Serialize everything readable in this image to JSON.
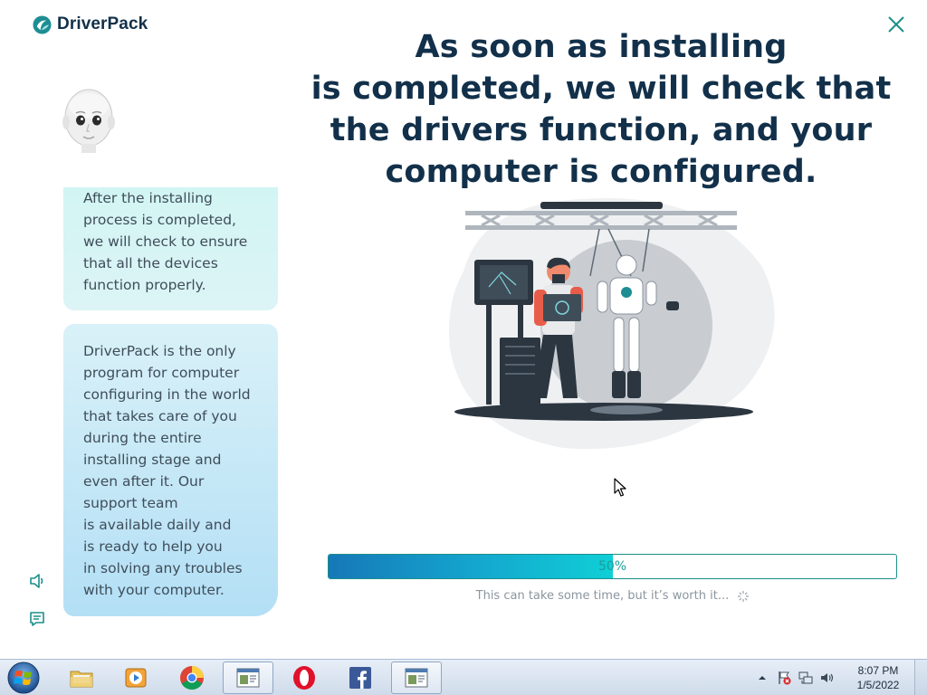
{
  "app": {
    "brand": "DriverPack",
    "headline": "As soon as installing\nis completed, we will check that\nthe drivers function, and your\ncomputer is configured.",
    "bubbles": [
      "After the installing\nprocess is completed,\nwe will check to ensure\nthat all the devices\nfunction properly.",
      "DriverPack is the only\nprogram for computer\nconfiguring in the world\nthat takes care of you\nduring the entire\ninstalling stage and\neven after it. Our\nsupport team\nis available daily and\nis ready to help you\nin solving any troubles\nwith your computer."
    ],
    "progress": {
      "value": 50,
      "label": "50%"
    },
    "hint": "This can take some time, but it’s worth it...",
    "icons": {
      "close": "close-icon",
      "speaker": "speaker-icon",
      "chat": "chat-icon",
      "avatar": "avatar-face"
    },
    "colors": {
      "brand_dark": "#12304a",
      "accent_teal": "#1c8f8a",
      "progress_start": "#1678b8",
      "progress_end": "#10cfd6"
    }
  },
  "taskbar": {
    "apps": [
      {
        "name": "explorer",
        "icon": "folder-icon"
      },
      {
        "name": "media-player",
        "icon": "media-player-icon"
      },
      {
        "name": "chrome",
        "icon": "chrome-icon"
      },
      {
        "name": "window-1",
        "icon": "window-icon"
      },
      {
        "name": "opera",
        "icon": "opera-icon"
      },
      {
        "name": "facebook",
        "icon": "facebook-icon"
      },
      {
        "name": "window-2",
        "icon": "window-icon"
      }
    ],
    "clock": {
      "time": "8:07 PM",
      "date": "1/5/2022"
    }
  }
}
